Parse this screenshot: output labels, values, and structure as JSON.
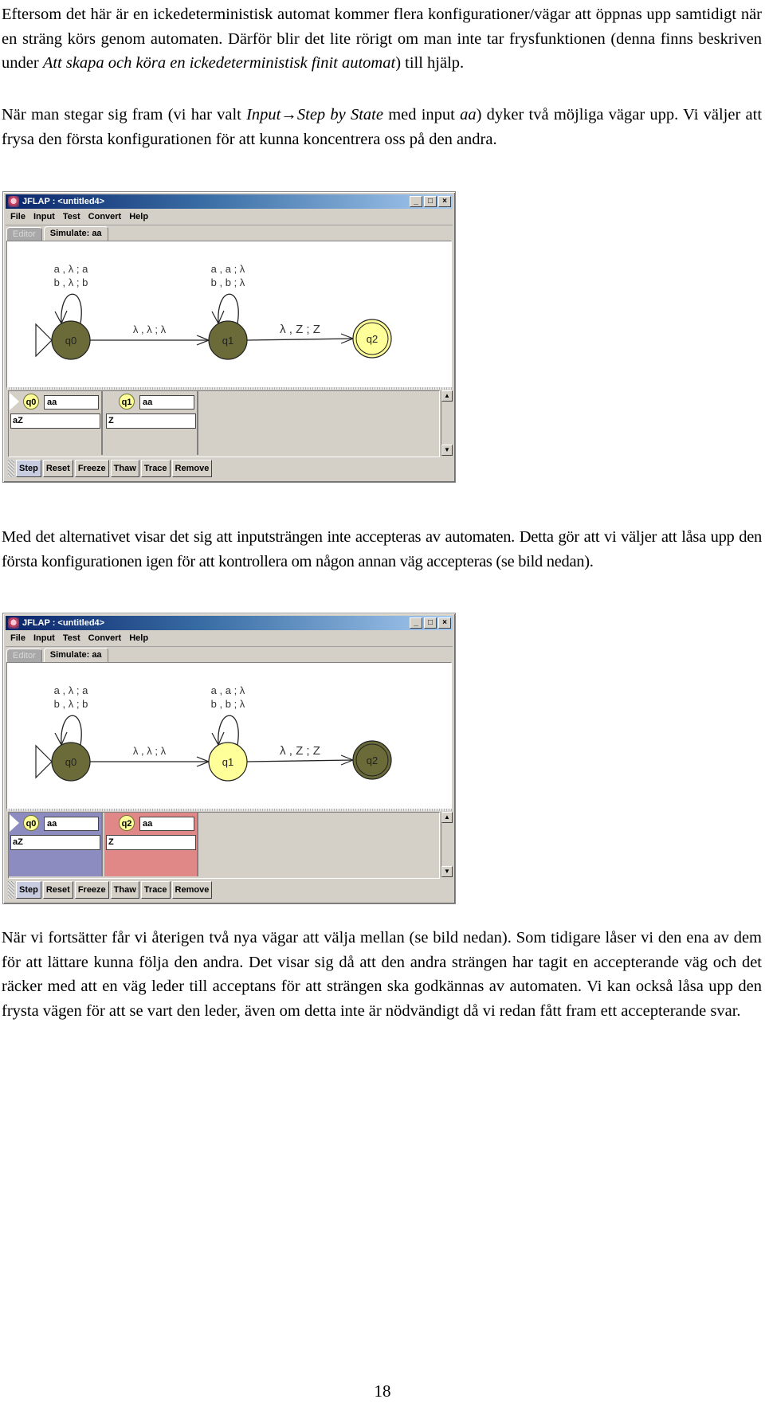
{
  "paragraphs": {
    "p1": {
      "a": "Eftersom det här är en ickedeterministisk automat kommer flera konfigurationer/vägar att öppnas upp samtidigt när en sträng körs genom automaten. Därför blir det lite rörigt om man inte tar frysfunktionen (denna finns beskriven under ",
      "italic": "Att skapa och köra en ickedeterministisk finit automat",
      "b": ") till hjälp."
    },
    "p2": {
      "a": "När man stegar sig fram (vi har valt ",
      "i1": "Input",
      "arrow": "→",
      "i2": "Step by State",
      "b": " med input ",
      "i3": "aa",
      "c": ") dyker två möjliga vägar upp. Vi väljer att frysa den första konfigurationen för att kunna koncentrera oss på den andra."
    },
    "p3": "Med det alternativet visar det sig att inputsträngen inte accepteras av automaten. Detta gör att vi väljer att låsa upp den första konfigurationen igen för att kontrollera om någon annan väg accepteras (se bild nedan).",
    "p4": "När vi fortsätter får vi återigen två nya vägar att välja mellan (se bild nedan). Som tidigare låser vi den ena av dem för att lättare kunna följa den andra. Det visar sig då att den andra strängen har tagit en accepterande väg och det räcker med att en väg leder till acceptans för att strängen ska godkännas av automaten. Vi kan också låsa upp den frysta vägen för att se vart den leder, även om detta inte är nödvändigt då vi redan fått fram ett accepterande svar."
  },
  "page_number": "18",
  "colors": {
    "state_inactive": "#6b6b3a",
    "state_active": "#ffff99",
    "frozen_config": "#8c8cc0",
    "rejected_config": "#e08888"
  },
  "screenshots": [
    {
      "window_title": "JFLAP : <untitled4>",
      "window_buttons": [
        "_",
        "□",
        "×"
      ],
      "menu": [
        "File",
        "Input",
        "Test",
        "Convert",
        "Help"
      ],
      "tabs": [
        "Editor",
        "Simulate: aa"
      ],
      "automaton": {
        "states": [
          {
            "id": "q0",
            "initial": true,
            "final": false,
            "highlighted": false
          },
          {
            "id": "q1",
            "initial": false,
            "final": false,
            "highlighted": false
          },
          {
            "id": "q2",
            "initial": false,
            "final": true,
            "highlighted": true
          }
        ],
        "transitions": [
          {
            "from": "q0",
            "to": "q0",
            "labels": [
              "a , λ ; a",
              "b , λ ; b"
            ]
          },
          {
            "from": "q1",
            "to": "q1",
            "labels": [
              "a , a ; λ",
              "b , b ; λ"
            ]
          },
          {
            "from": "q0",
            "to": "q1",
            "labels": [
              "λ , λ ; λ"
            ]
          },
          {
            "from": "q1",
            "to": "q2",
            "labels": [
              "λ , Z ; Z"
            ]
          }
        ]
      },
      "configurations": [
        {
          "state": "q0",
          "initial": true,
          "input": "aa",
          "stack": "aZ",
          "status": "normal"
        },
        {
          "state": "q1",
          "initial": false,
          "input": "aa",
          "stack": "Z",
          "status": "normal"
        }
      ],
      "buttons": [
        "Step",
        "Reset",
        "Freeze",
        "Thaw",
        "Trace",
        "Remove"
      ]
    },
    {
      "window_title": "JFLAP : <untitled4>",
      "window_buttons": [
        "_",
        "□",
        "×"
      ],
      "menu": [
        "File",
        "Input",
        "Test",
        "Convert",
        "Help"
      ],
      "tabs": [
        "Editor",
        "Simulate: aa"
      ],
      "automaton": {
        "states": [
          {
            "id": "q0",
            "initial": true,
            "final": false,
            "highlighted": false
          },
          {
            "id": "q1",
            "initial": false,
            "final": false,
            "highlighted": true
          },
          {
            "id": "q2",
            "initial": false,
            "final": true,
            "highlighted": false
          }
        ],
        "transitions": [
          {
            "from": "q0",
            "to": "q0",
            "labels": [
              "a , λ ; a",
              "b , λ ; b"
            ]
          },
          {
            "from": "q1",
            "to": "q1",
            "labels": [
              "a , a ; λ",
              "b , b ; λ"
            ]
          },
          {
            "from": "q0",
            "to": "q1",
            "labels": [
              "λ , λ ; λ"
            ]
          },
          {
            "from": "q1",
            "to": "q2",
            "labels": [
              "λ , Z ; Z"
            ]
          }
        ]
      },
      "configurations": [
        {
          "state": "q0",
          "initial": true,
          "input": "aa",
          "stack": "aZ",
          "status": "frozen"
        },
        {
          "state": "q2",
          "initial": false,
          "input": "aa",
          "stack": "Z",
          "status": "rejected"
        }
      ],
      "buttons": [
        "Step",
        "Reset",
        "Freeze",
        "Thaw",
        "Trace",
        "Remove"
      ]
    }
  ]
}
